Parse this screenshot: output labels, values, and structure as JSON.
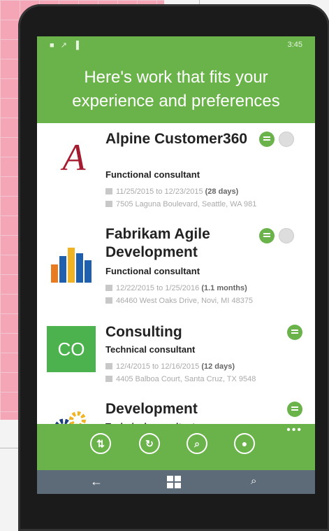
{
  "status": {
    "left": "■ ↗ ▐",
    "right": "3:45"
  },
  "header": {
    "title": "Here's work that fits your experience and preferences"
  },
  "items": [
    {
      "title": "Alpine Customer360",
      "role": "Functional consultant",
      "dates": "11/25/2015 to 12/23/2015",
      "duration": "(28 days)",
      "address": "7505 Laguna Boulevard, Seattle, WA 981"
    },
    {
      "title": "Fabrikam Agile Development",
      "role": "Functional consultant",
      "dates": "12/22/2015 to 1/25/2016",
      "duration": "(1.1 months)",
      "address": "46460 West Oaks Drive, Novi, MI 48375"
    },
    {
      "title": "Consulting",
      "role": "Technical consultant",
      "dates": "12/4/2015 to 12/16/2015",
      "duration": "(12 days)",
      "address": "4405 Balboa Court, Santa Cruz, TX 9548",
      "logo_text": "CO"
    },
    {
      "title": "Development",
      "role": "Technical consultant"
    }
  ],
  "appbar": {
    "more": "•••"
  },
  "nav": {
    "back": "←",
    "search": "⌕"
  },
  "colors": {
    "accent": "#6ab34a",
    "nav": "#5d6b79"
  }
}
